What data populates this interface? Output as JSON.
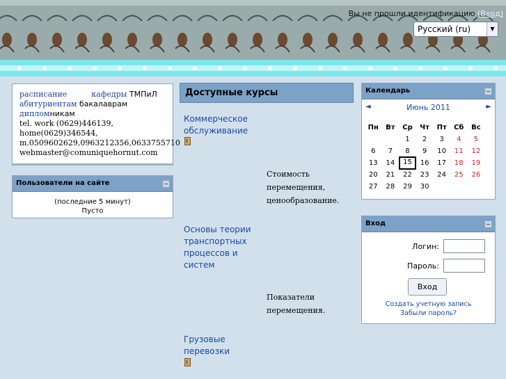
{
  "header": {
    "login_text": "Вы не прошли идентификацию",
    "login_link": "(Вход)",
    "language": "Русский (ru)"
  },
  "links_block": {
    "links": [
      "расписание",
      "кафедры",
      "абитуриентам",
      "диплом"
    ],
    "texts": [
      "ТМПиЛ",
      "бакалаврам",
      "никам"
    ],
    "lines": [
      "tel. work (0629)446139,",
      "home(0629)346544,",
      "m.0509602629,0963212356,0633755710",
      "webmaster@comuniquehornut.com"
    ]
  },
  "users_block": {
    "title": "Пользователи на сайте",
    "period": "(последние 5 минут)",
    "status": "Пусто"
  },
  "courses": {
    "title": "Доступные курсы",
    "items": [
      {
        "name": "Коммерческое обслуживание",
        "summary": "Стоимость перемещения, ценообразование."
      },
      {
        "name": "Основы теории транспортных процессов и систем",
        "summary": "Показатели перемещения."
      },
      {
        "name": "Грузовые перевозки",
        "summary": ""
      }
    ]
  },
  "calendar": {
    "title": "Календарь",
    "month": "Июнь 2011",
    "prev": "◄",
    "next": "►",
    "dow": [
      "Пн",
      "Вт",
      "Ср",
      "Чт",
      "Пт",
      "Сб",
      "Вс"
    ],
    "weeks": [
      [
        "",
        "",
        "1",
        "2",
        "3",
        "4",
        "5"
      ],
      [
        "6",
        "7",
        "8",
        "9",
        "10",
        "11",
        "12"
      ],
      [
        "13",
        "14",
        "15",
        "16",
        "17",
        "18",
        "19"
      ],
      [
        "20",
        "21",
        "22",
        "23",
        "24",
        "25",
        "26"
      ],
      [
        "27",
        "28",
        "29",
        "30",
        "",
        "",
        ""
      ]
    ],
    "today": "15"
  },
  "login_block": {
    "title": "Вход",
    "login_label": "Логин:",
    "password_label": "Пароль:",
    "submit": "Вход",
    "create_account": "Создать учетную запись",
    "forgot": "Забыли пароль?"
  },
  "colors": {
    "accent": "#7da2c8",
    "link": "#1a47a3",
    "background": "#d2e0ec",
    "weekend": "#d21f1f"
  }
}
